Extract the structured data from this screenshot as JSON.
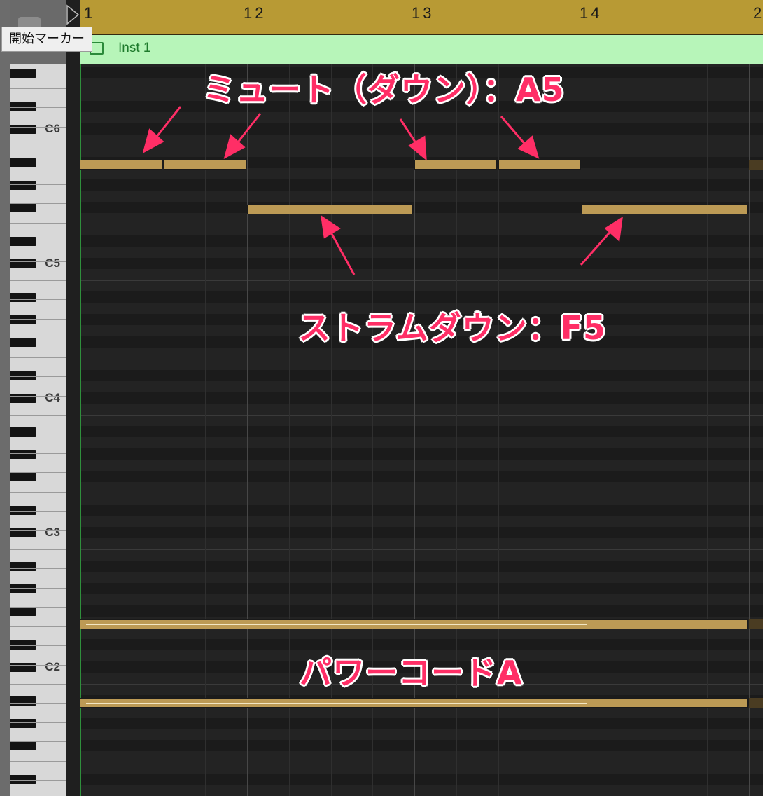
{
  "ruler": {
    "bars": [
      "1",
      "12",
      "13",
      "14",
      "2"
    ]
  },
  "region": {
    "name": "Inst 1"
  },
  "tooltip": {
    "text": "開始マーカー"
  },
  "keyboard": {
    "octave_labels": [
      "C6",
      "C5",
      "C4",
      "C3",
      "C2"
    ]
  },
  "annotations": {
    "mute": "ミュート（ダウン）：A5",
    "strum": "ストラムダウン：F5",
    "power": "パワーコードA"
  },
  "colors": {
    "note": "#bc9a55",
    "annotation": "#ff2e66",
    "ruler": "#b89a34",
    "region": "#b7f5b9"
  },
  "notes": [
    {
      "pitch": "A5",
      "start": 1.0,
      "length": 0.5
    },
    {
      "pitch": "A5",
      "start": 1.5,
      "length": 0.5
    },
    {
      "pitch": "F5",
      "start": 2.0,
      "length": 1.0
    },
    {
      "pitch": "A5",
      "start": 3.0,
      "length": 0.5
    },
    {
      "pitch": "A5",
      "start": 3.5,
      "length": 0.5
    },
    {
      "pitch": "F5",
      "start": 4.0,
      "length": 1.0
    },
    {
      "pitch": "power-chord-A-high",
      "start": 1.0,
      "length": 4.0
    },
    {
      "pitch": "power-chord-A-low",
      "start": 1.0,
      "length": 4.0
    }
  ]
}
